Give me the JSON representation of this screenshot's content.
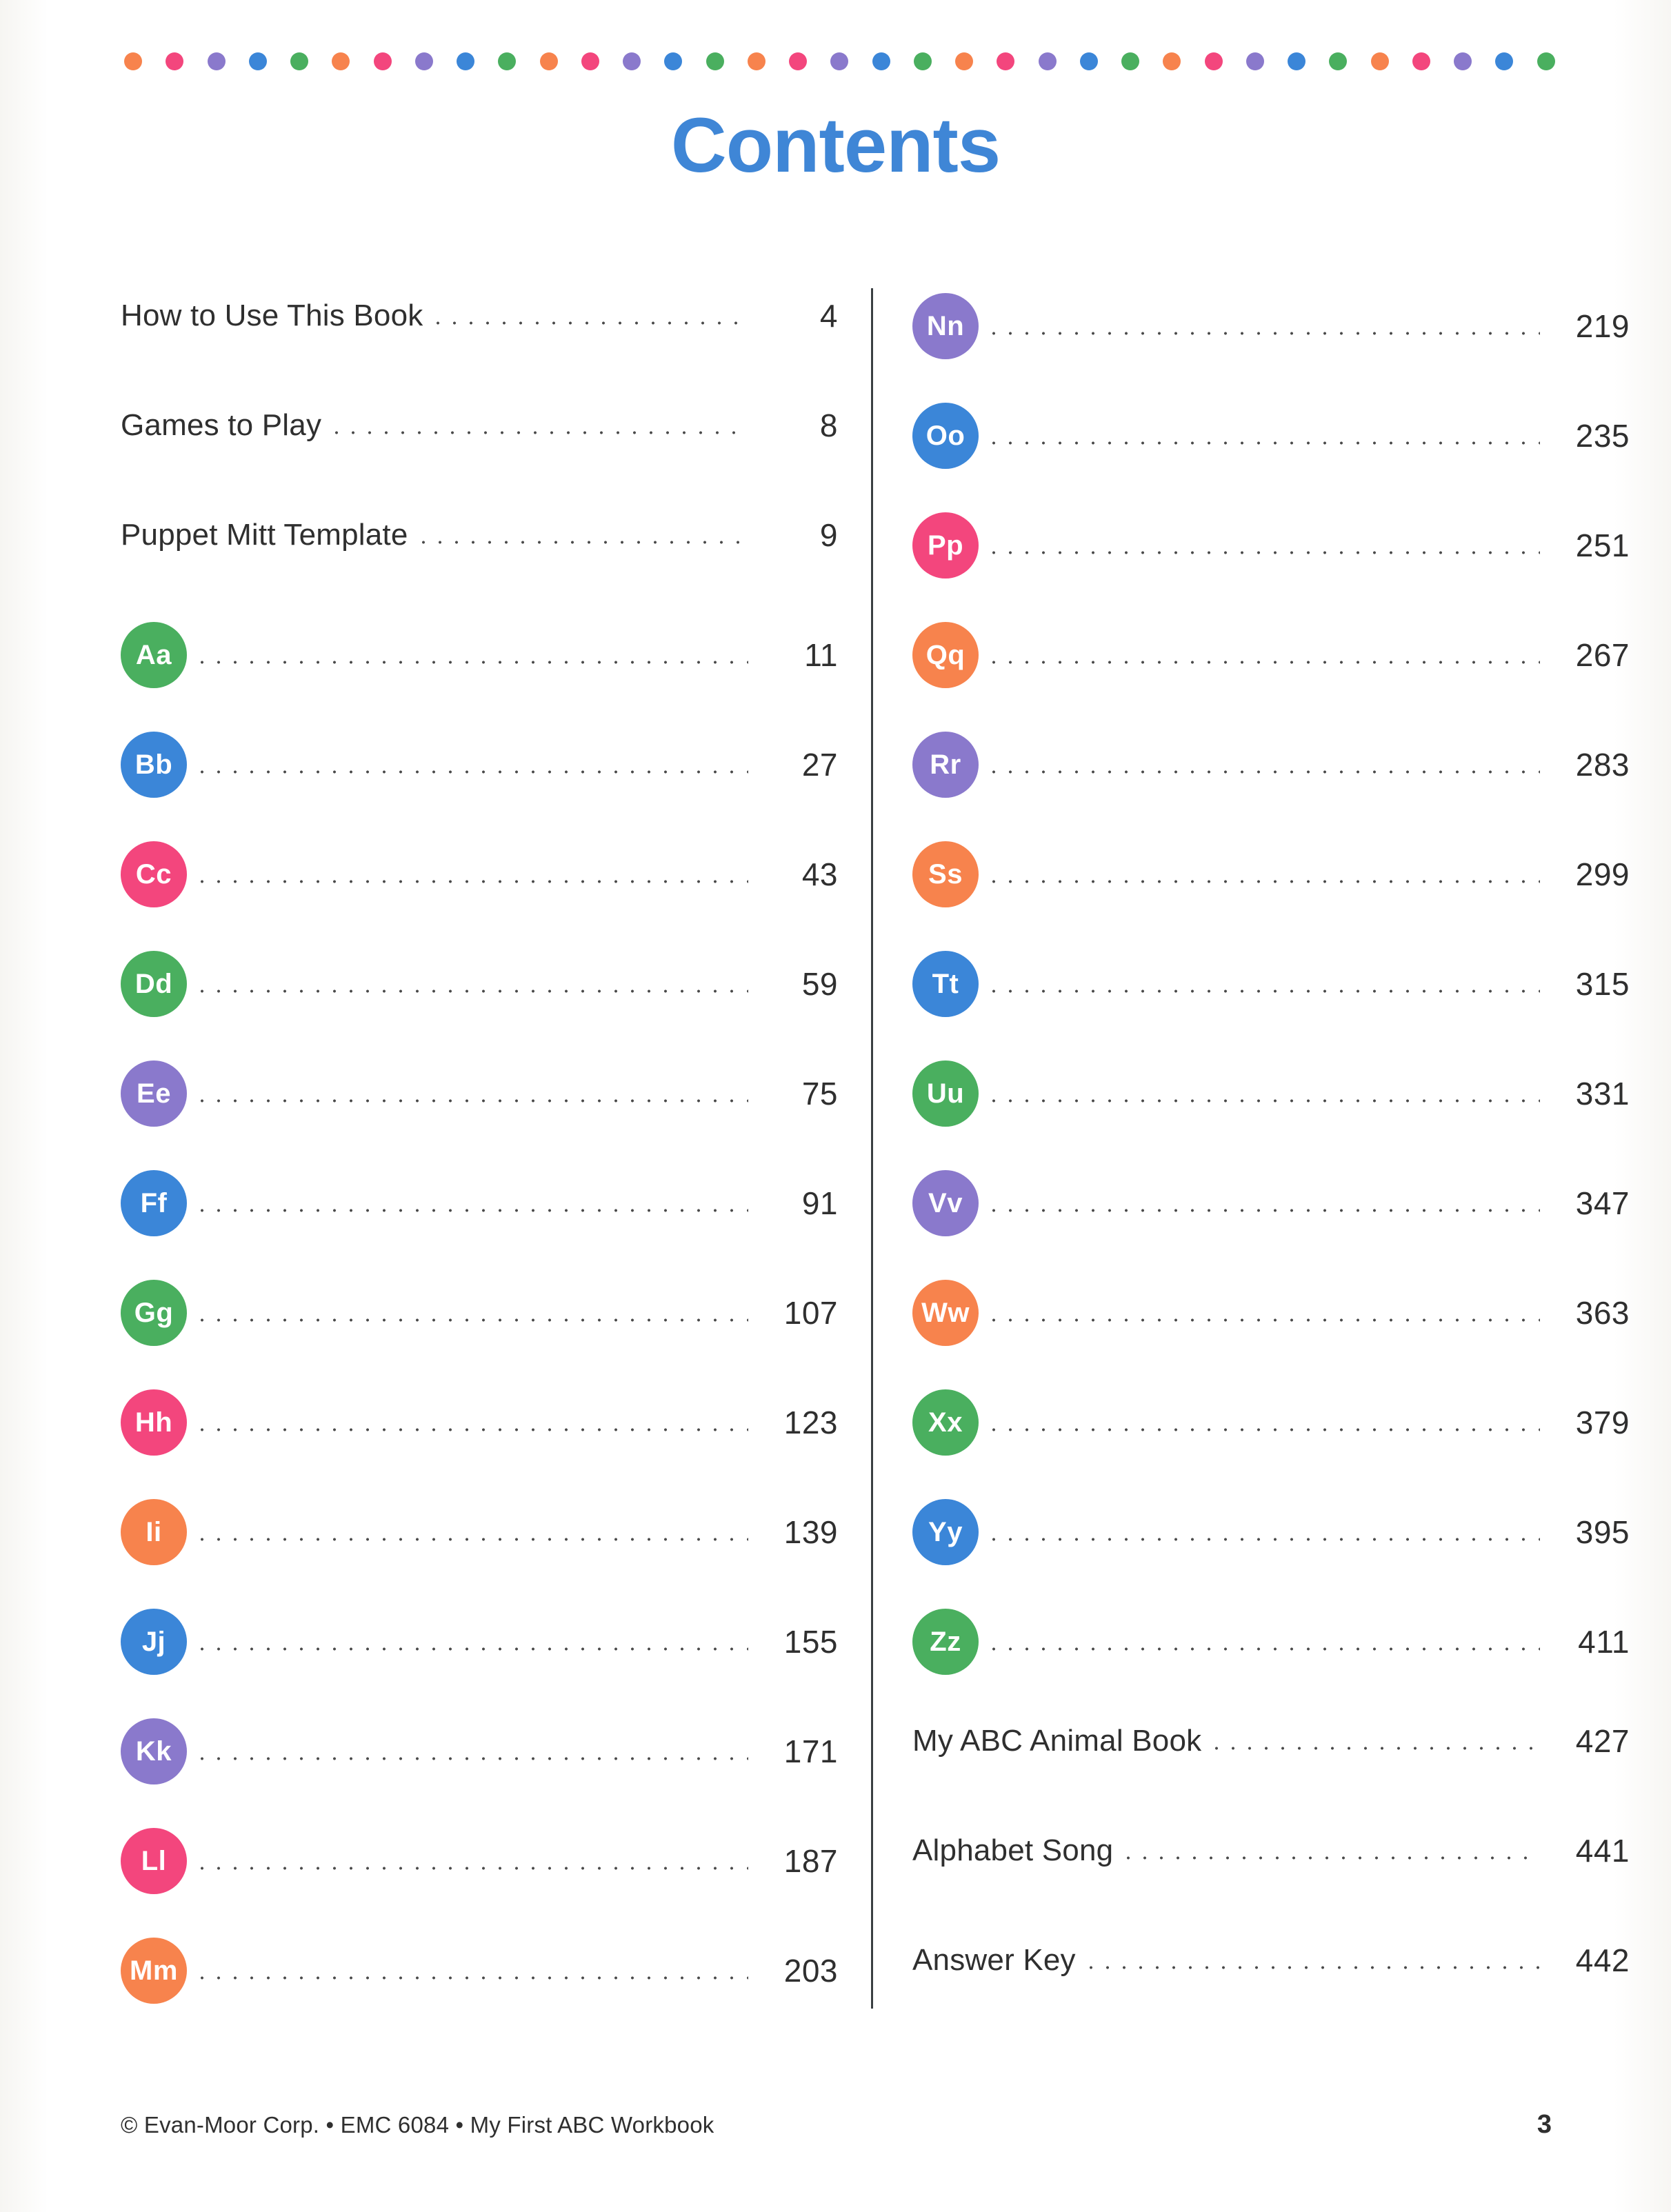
{
  "page": {
    "title": "Contents",
    "title_color": "#3f86d6",
    "footer_credit": "© Evan-Moor Corp. • EMC 6084 • My First ABC Workbook",
    "footer_page_number": "3"
  },
  "palette": {
    "orange": "#f7834d",
    "pink": "#f3467d",
    "purple": "#8a79cc",
    "blue": "#3b86d8",
    "green": "#4aaf5f"
  },
  "dot_rule": {
    "sequence": [
      "orange",
      "pink",
      "purple",
      "blue",
      "green"
    ],
    "count": 35
  },
  "left_column": [
    {
      "type": "text",
      "label": "How to Use This Book",
      "page": "4"
    },
    {
      "type": "text",
      "label": "Games to Play",
      "page": "8"
    },
    {
      "type": "text",
      "label": "Puppet Mitt Template",
      "page": "9"
    },
    {
      "type": "letter",
      "label": "Aa",
      "color": "green",
      "page": "11"
    },
    {
      "type": "letter",
      "label": "Bb",
      "color": "blue",
      "page": "27"
    },
    {
      "type": "letter",
      "label": "Cc",
      "color": "pink",
      "page": "43"
    },
    {
      "type": "letter",
      "label": "Dd",
      "color": "green",
      "page": "59"
    },
    {
      "type": "letter",
      "label": "Ee",
      "color": "purple",
      "page": "75"
    },
    {
      "type": "letter",
      "label": "Ff",
      "color": "blue",
      "page": "91"
    },
    {
      "type": "letter",
      "label": "Gg",
      "color": "green",
      "page": "107"
    },
    {
      "type": "letter",
      "label": "Hh",
      "color": "pink",
      "page": "123"
    },
    {
      "type": "letter",
      "label": "Ii",
      "color": "orange",
      "page": "139"
    },
    {
      "type": "letter",
      "label": "Jj",
      "color": "blue",
      "page": "155"
    },
    {
      "type": "letter",
      "label": "Kk",
      "color": "purple",
      "page": "171"
    },
    {
      "type": "letter",
      "label": "Ll",
      "color": "pink",
      "page": "187"
    },
    {
      "type": "letter",
      "label": "Mm",
      "color": "orange",
      "page": "203"
    }
  ],
  "right_column": [
    {
      "type": "letter",
      "label": "Nn",
      "color": "purple",
      "page": "219"
    },
    {
      "type": "letter",
      "label": "Oo",
      "color": "blue",
      "page": "235"
    },
    {
      "type": "letter",
      "label": "Pp",
      "color": "pink",
      "page": "251"
    },
    {
      "type": "letter",
      "label": "Qq",
      "color": "orange",
      "page": "267"
    },
    {
      "type": "letter",
      "label": "Rr",
      "color": "purple",
      "page": "283"
    },
    {
      "type": "letter",
      "label": "Ss",
      "color": "orange",
      "page": "299"
    },
    {
      "type": "letter",
      "label": "Tt",
      "color": "blue",
      "page": "315"
    },
    {
      "type": "letter",
      "label": "Uu",
      "color": "green",
      "page": "331"
    },
    {
      "type": "letter",
      "label": "Vv",
      "color": "purple",
      "page": "347"
    },
    {
      "type": "letter",
      "label": "Ww",
      "color": "orange",
      "page": "363"
    },
    {
      "type": "letter",
      "label": "Xx",
      "color": "green",
      "page": "379"
    },
    {
      "type": "letter",
      "label": "Yy",
      "color": "blue",
      "page": "395"
    },
    {
      "type": "letter",
      "label": "Zz",
      "color": "green",
      "page": "411"
    },
    {
      "type": "text",
      "label": "My ABC Animal Book",
      "page": "427"
    },
    {
      "type": "text",
      "label": "Alphabet Song",
      "page": "441"
    },
    {
      "type": "text",
      "label": "Answer Key",
      "page": "442"
    }
  ]
}
